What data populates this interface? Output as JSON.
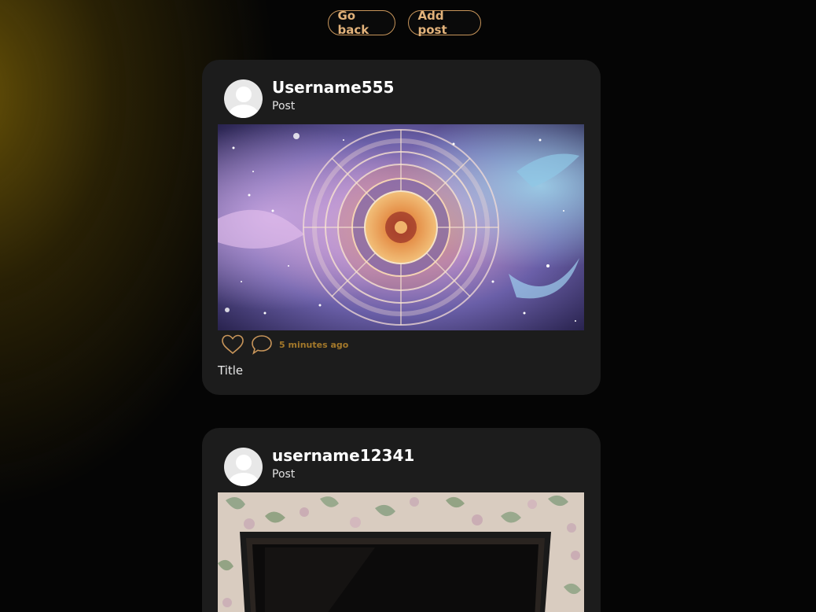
{
  "toolbar": {
    "back_label": "Go back",
    "add_label": "Add post"
  },
  "posts": [
    {
      "username": "Username555",
      "type": "Post",
      "time_ago": "5 minutes ago",
      "title": "Title",
      "image": "zodiac-wheel-galaxy-illustration"
    },
    {
      "username": "username12341",
      "type": "Post",
      "image": "television-on-floral-wallpaper-photo"
    }
  ],
  "colors": {
    "accent": "#c8955a",
    "accent_text": "#e2b27a",
    "card_bg": "#1c1c1c",
    "time_text": "#a3782a"
  },
  "icons": {
    "like": "heart-outline-icon",
    "comment": "speech-bubble-icon",
    "avatar": "user-avatar-placeholder"
  }
}
